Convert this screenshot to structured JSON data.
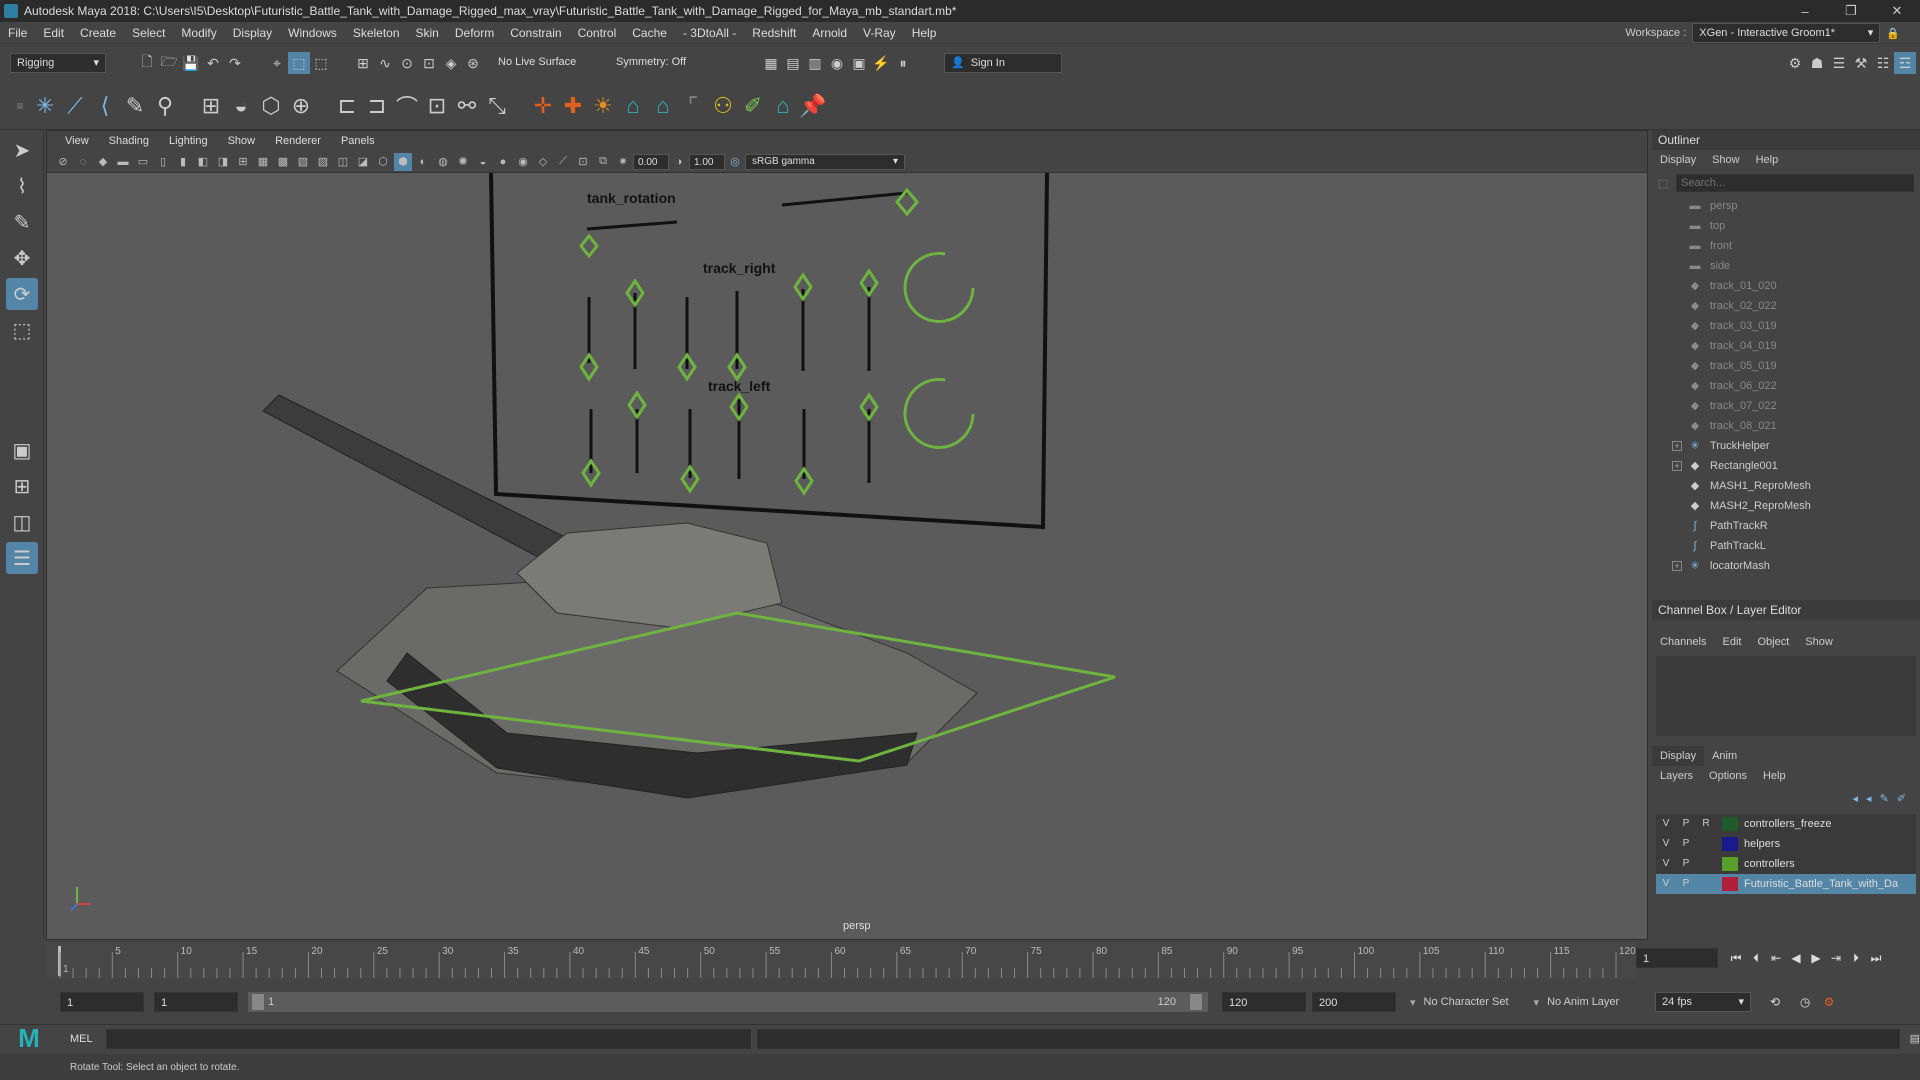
{
  "window": {
    "title": "Autodesk Maya 2018: C:\\Users\\I5\\Desktop\\Futuristic_Battle_Tank_with_Damage_Rigged_max_vray\\Futuristic_Battle_Tank_with_Damage_Rigged_for_Maya_mb_standart.mb*",
    "minimize": "–",
    "maximize": "❐",
    "close": "✕"
  },
  "menu": [
    "File",
    "Edit",
    "Create",
    "Select",
    "Modify",
    "Display",
    "Windows",
    "Skeleton",
    "Skin",
    "Deform",
    "Constrain",
    "Control",
    "Cache",
    "- 3DtoAll -",
    "Redshift",
    "Arnold",
    "V-Ray",
    "Help"
  ],
  "workspace": {
    "label": "Workspace :",
    "value": "XGen - Interactive Groom1*"
  },
  "statusline": {
    "mode": "Rigging",
    "live_surface": "No Live Surface",
    "symmetry": "Symmetry: Off",
    "sign_in": "Sign In"
  },
  "viewport": {
    "menu": [
      "View",
      "Shading",
      "Lighting",
      "Show",
      "Renderer",
      "Panels"
    ],
    "exposure": "0.00",
    "gamma": "1.00",
    "color_space": "sRGB gamma",
    "camera_label": "persp",
    "labels": {
      "rotation": "tank_rotation",
      "right": "track_right",
      "left": "track_left"
    }
  },
  "outliner": {
    "title": "Outliner",
    "menu": [
      "Display",
      "Show",
      "Help"
    ],
    "search_placeholder": "Search...",
    "items": [
      {
        "label": "persp",
        "icon": "camera-icon",
        "dim": true,
        "expand": false
      },
      {
        "label": "top",
        "icon": "camera-icon",
        "dim": true,
        "expand": false
      },
      {
        "label": "front",
        "icon": "camera-icon",
        "dim": true,
        "expand": false
      },
      {
        "label": "side",
        "icon": "camera-icon",
        "dim": true,
        "expand": false
      },
      {
        "label": "track_01_020",
        "icon": "mesh-icon",
        "dim": true,
        "expand": false
      },
      {
        "label": "track_02_022",
        "icon": "mesh-icon",
        "dim": true,
        "expand": false
      },
      {
        "label": "track_03_019",
        "icon": "mesh-icon",
        "dim": true,
        "expand": false
      },
      {
        "label": "track_04_019",
        "icon": "mesh-icon",
        "dim": true,
        "expand": false
      },
      {
        "label": "track_05_019",
        "icon": "mesh-icon",
        "dim": true,
        "expand": false
      },
      {
        "label": "track_06_022",
        "icon": "mesh-icon",
        "dim": true,
        "expand": false
      },
      {
        "label": "track_07_022",
        "icon": "mesh-icon",
        "dim": true,
        "expand": false
      },
      {
        "label": "track_08_021",
        "icon": "mesh-icon",
        "dim": true,
        "expand": false
      },
      {
        "label": "TruckHelper",
        "icon": "helper-icon",
        "dim": false,
        "expand": true
      },
      {
        "label": "Rectangle001",
        "icon": "mesh-icon",
        "dim": false,
        "expand": true
      },
      {
        "label": "MASH1_ReproMesh",
        "icon": "mesh-icon",
        "dim": false,
        "expand": false
      },
      {
        "label": "MASH2_ReproMesh",
        "icon": "mesh-icon",
        "dim": false,
        "expand": false
      },
      {
        "label": "PathTrackR",
        "icon": "curve-icon",
        "dim": false,
        "expand": false
      },
      {
        "label": "PathTrackL",
        "icon": "curve-icon",
        "dim": false,
        "expand": false
      },
      {
        "label": "locatorMash",
        "icon": "helper-icon",
        "dim": false,
        "expand": true
      }
    ]
  },
  "channelbox": {
    "title": "Channel Box / Layer Editor",
    "menu": [
      "Channels",
      "Edit",
      "Object",
      "Show"
    ],
    "tabs": [
      "Display",
      "Anim"
    ],
    "layer_menu": [
      "Layers",
      "Options",
      "Help"
    ],
    "layers": [
      {
        "v": "V",
        "p": "P",
        "r": "R",
        "color": "#1d5b2a",
        "name": "controllers_freeze",
        "selected": false
      },
      {
        "v": "V",
        "p": "P",
        "r": "",
        "color": "#1a1a8c",
        "name": "helpers",
        "selected": false
      },
      {
        "v": "V",
        "p": "P",
        "r": "",
        "color": "#5aa02c",
        "name": "controllers",
        "selected": false
      },
      {
        "v": "V",
        "p": "P",
        "r": "",
        "color": "#b0203a",
        "name": "Futuristic_Battle_Tank_with_Da",
        "selected": true
      }
    ]
  },
  "timeline": {
    "ticks": [
      "1",
      "5",
      "10",
      "15",
      "20",
      "25",
      "30",
      "35",
      "40",
      "45",
      "50",
      "55",
      "60",
      "65",
      "70",
      "75",
      "80",
      "85",
      "90",
      "95",
      "100",
      "105",
      "110",
      "115",
      "120"
    ],
    "current_frame": "1"
  },
  "range": {
    "start": "1",
    "anim_start": "1",
    "slider_start": "1",
    "slider_end": "120",
    "end": "120",
    "anim_end": "200",
    "character_set": "No Character Set",
    "anim_layer": "No Anim Layer",
    "fps": "24 fps"
  },
  "cmd": {
    "lang": "MEL"
  },
  "help": {
    "text": "Rotate Tool: Select an object to rotate."
  },
  "colors": {
    "accent": "#5285a6",
    "control_green": "#6eb43f"
  }
}
